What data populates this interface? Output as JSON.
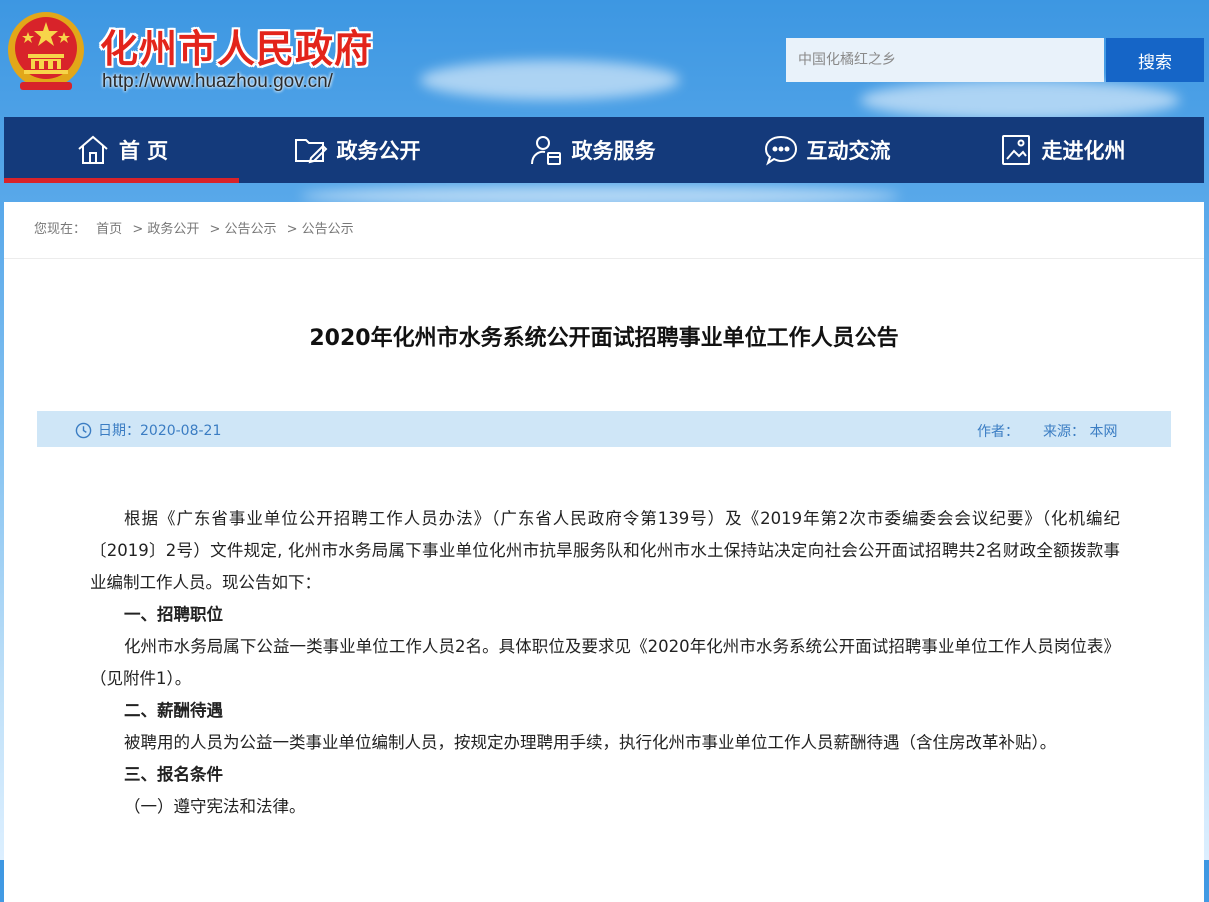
{
  "header": {
    "site_title": "化州市人民政府",
    "site_url": "http://www.huazhou.gov.cn/",
    "search_placeholder": "中国化橘红之乡",
    "search_button": "搜索"
  },
  "nav": {
    "items": [
      {
        "label": "首 页",
        "icon": "home-icon",
        "active": true
      },
      {
        "label": "政务公开",
        "icon": "folder-pen-icon"
      },
      {
        "label": "政务服务",
        "icon": "user-calendar-icon"
      },
      {
        "label": "互动交流",
        "icon": "chat-bubble-icon"
      },
      {
        "label": "走进化州",
        "icon": "picture-frame-icon"
      }
    ]
  },
  "breadcrumb": {
    "prefix": "您现在：",
    "items": [
      "首页",
      "> 政务公开",
      "> 公告公示",
      "> 公告公示"
    ]
  },
  "article": {
    "title": "2020年化州市水务系统公开面试招聘事业单位工作人员公告",
    "date": "日期：2020-08-21",
    "author": "作者：",
    "source": "来源：  本网",
    "p1": "根据《广东省事业单位公开招聘工作人员办法》（广东省人民政府令第139号）及《2019年第2次市委编委会会议纪要》（化机编纪〔2019〕2号）文件规定, 化州市水务局属下事业单位化州市抗旱服务队和化州市水土保持站决定向社会公开面试招聘共2名财政全额拨款事业编制工作人员。现公告如下：",
    "h1": "一、招聘职位",
    "p2": "化州市水务局属下公益一类事业单位工作人员2名。具体职位及要求见《2020年化州市水务系统公开面试招聘事业单位工作人员岗位表》（见附件1）。",
    "h2": "二、薪酬待遇",
    "p3": "被聘用的人员为公益一类事业单位编制人员，按规定办理聘用手续，执行化州市事业单位工作人员薪酬待遇（含住房改革补贴）。",
    "h3": "三、报名条件",
    "p4": "（一）遵守宪法和法律。"
  },
  "colors": {
    "nav_bg": "#143a7b",
    "nav_active": "#d8232a",
    "title_red": "#e3241b",
    "search_button": "#1565c7",
    "meta_bar": "#cfe6f7"
  }
}
